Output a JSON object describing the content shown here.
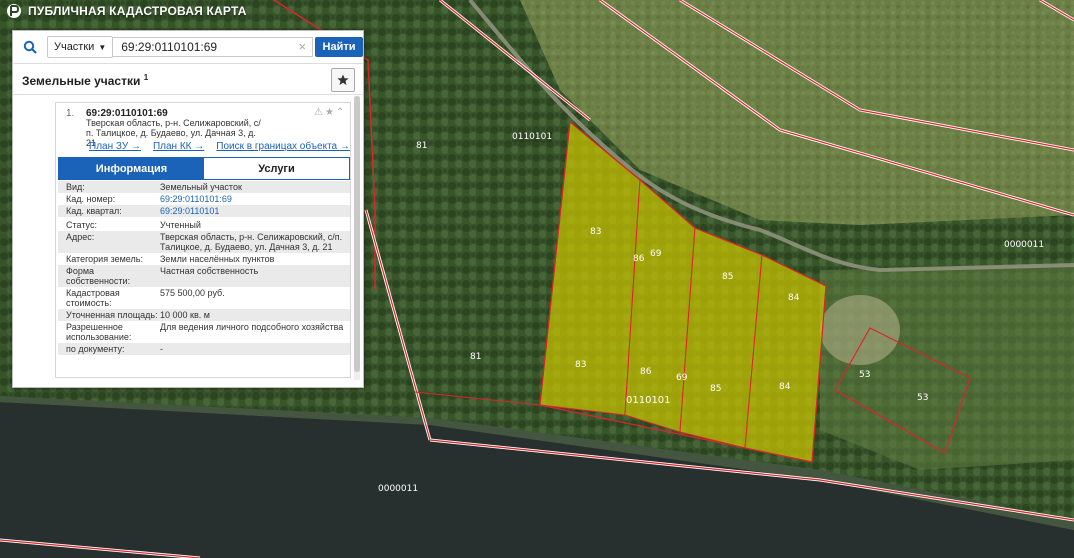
{
  "app": {
    "title": "ПУБЛИЧНАЯ КАДАСТРОВАЯ КАРТА",
    "logo_icon": "pkk-logo-icon"
  },
  "search": {
    "icon": "search-icon",
    "type_label": "Участки",
    "query": "69:29:0110101:69",
    "find_label": "Найти"
  },
  "results": {
    "title": "Земельные участки",
    "count": "1",
    "items": [
      {
        "rank": "1.",
        "number": "69:29:0110101:69",
        "address": "Тверская область, р-н. Селижаровский, с/п. Талицкое, д. Будаево, ул. Дачная 3, д. 21",
        "links": [
          "План ЗУ →",
          "План КК →",
          "Поиск в границах объекта →"
        ]
      }
    ],
    "tabs": [
      "Информация",
      "Услуги"
    ]
  },
  "info": [
    {
      "key": "Вид:",
      "value": "Земельный участок"
    },
    {
      "key": "Кад. номер:",
      "value": "69:29:0110101:69"
    },
    {
      "key": "Кад. квартал:",
      "value": "69:29:0110101"
    },
    {
      "key": "Статус:",
      "value": "Учтенный"
    },
    {
      "key": "Адрес:",
      "value": "Тверская область, р-н. Селижаровский, с/п. Талицкое, д. Будаево, ул. Дачная 3, д. 21"
    },
    {
      "key": "Категория земель:",
      "value": "Земли населённых пунктов"
    },
    {
      "key": "Форма собственности:",
      "value": "Частная собственность"
    },
    {
      "key": "Кадастровая стоимость:",
      "value": "575 500,00 руб."
    },
    {
      "key": "Уточненная площадь:",
      "value": "10 000 кв. м"
    },
    {
      "key": "Разрешенное использование:",
      "value": "Для ведения личного подсобного хозяйства"
    },
    {
      "key": "по документу:",
      "value": "-"
    }
  ],
  "map_labels": {
    "quarter_top": "0110101",
    "quarter_right": "0000011",
    "quarter_bottom": "0000011",
    "quarter_center": "0110101",
    "label_81a": "81",
    "label_81b": "81",
    "p83a": "83",
    "p83b": "83",
    "p86a": "86",
    "p86b": "86",
    "p69a": "69",
    "p69b": "69",
    "p85a": "85",
    "p85b": "85",
    "p84a": "84",
    "p84b": "84",
    "p53a": "53",
    "p53b": "53"
  },
  "colors": {
    "parcel_fill": "#c9c400",
    "boundary": "#d9262b",
    "accent": "#1a63b8"
  }
}
